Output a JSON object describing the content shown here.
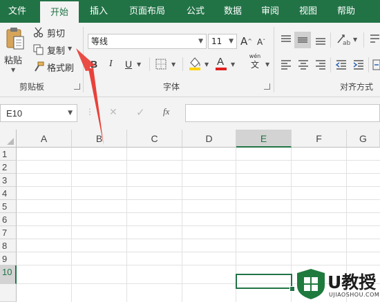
{
  "tabs": [
    {
      "label": "文件",
      "active": false
    },
    {
      "label": "开始",
      "active": true
    },
    {
      "label": "插入",
      "active": false
    },
    {
      "label": "页面布局",
      "active": false
    },
    {
      "label": "公式",
      "active": false
    },
    {
      "label": "数据",
      "active": false
    },
    {
      "label": "审阅",
      "active": false
    },
    {
      "label": "视图",
      "active": false
    },
    {
      "label": "帮助",
      "active": false
    }
  ],
  "clipboard": {
    "paste_label": "粘贴",
    "cut_label": "剪切",
    "copy_label": "复制",
    "format_painter_label": "格式刷",
    "group_label": "剪贴板"
  },
  "font": {
    "font_name": "等线",
    "font_size": "11",
    "bold": "B",
    "italic": "I",
    "underline": "U",
    "grow": "A",
    "shrink": "A",
    "phonetic_top": "wén",
    "phonetic_bottom": "文",
    "group_label": "字体"
  },
  "alignment": {
    "group_label": "对齐方式"
  },
  "formula_bar": {
    "name_box": "E10",
    "fx": "fx",
    "cancel": "✕",
    "enter": "✓",
    "formula": ""
  },
  "sheet": {
    "columns": [
      "A",
      "B",
      "C",
      "D",
      "E",
      "F",
      "G"
    ],
    "rows": [
      "1",
      "2",
      "3",
      "4",
      "5",
      "6",
      "7",
      "8",
      "9",
      "10"
    ],
    "selected_cell": "E10"
  },
  "colors": {
    "accent": "#217346",
    "arrow": "#e8423a",
    "fill_highlight": "#ffd400",
    "font_color": "#e02020"
  },
  "watermark": {
    "brand": "U教授",
    "url": "UJIAOSHOU.COM"
  }
}
